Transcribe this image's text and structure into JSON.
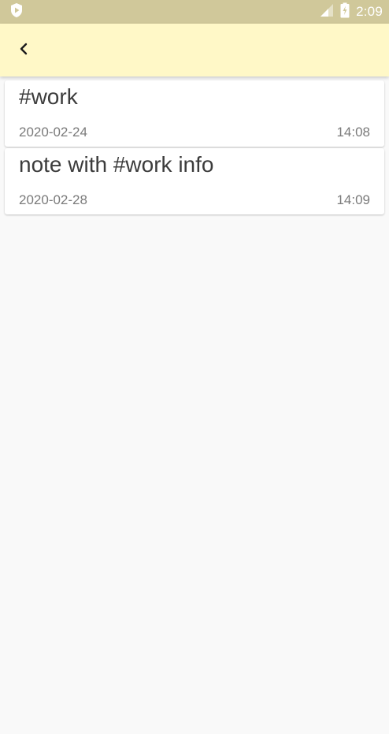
{
  "status_bar": {
    "time": "2:09",
    "icons": [
      "shield-play-icon",
      "signal-icon",
      "battery-charging-icon"
    ],
    "background_color": "#d0c89a"
  },
  "app_bar": {
    "back_icon": "chevron-left-icon",
    "background_color": "#fff8c7"
  },
  "notes": [
    {
      "title": "#work",
      "date": "2020-02-24",
      "time": "14:08"
    },
    {
      "title": "note with #work info",
      "date": "2020-02-28",
      "time": "14:09"
    }
  ],
  "colors": {
    "page_background": "#f9f9f9",
    "card_background": "#ffffff",
    "title_text": "#3c3c3c",
    "meta_text": "#7a7a7a"
  }
}
